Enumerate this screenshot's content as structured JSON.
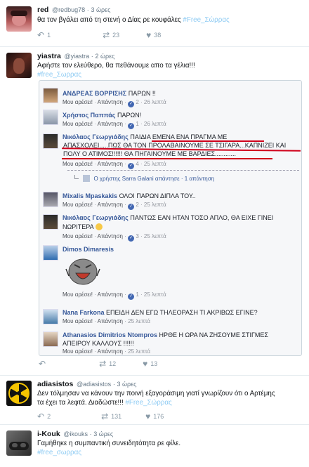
{
  "tweets": [
    {
      "name": "red",
      "handle": "@redbug78",
      "time": "3 ώρες",
      "text": "θα τον βγάλει από τη στενή ο Δίας ρε κουφάλες ",
      "hashtag": "#Free_Σώρρας",
      "replies": "1",
      "retweets": "23",
      "likes": "38"
    },
    {
      "name": "yiastra",
      "handle": "@yiastra",
      "time": "2 ώρες",
      "text": "Αφήστε τον ελεύθερο, θα πεθάνουμε απο τα γέλια!!!",
      "hashtag": "#free_Σωρρας",
      "replies": "",
      "retweets": "12",
      "likes": "13"
    },
    {
      "name": "adiasistos",
      "handle": "@adiasistos",
      "time": "3 ώρες",
      "text_line1": "Δεν τόλμησαν να κάνουν την ποινή εξαγοράσιμη γιατί γνωρίζουν ότι ο Αρτέμης",
      "text_line2": "τα έχει τα λεφτά. Διαδώστε!!! ",
      "hashtag": "#Free_Σώρρας",
      "replies": "2",
      "retweets": "131",
      "likes": "176"
    },
    {
      "name": "i-Kouk",
      "handle": "@ikouks",
      "time": "3 ώρες",
      "text": "Γαμήθηκε η συμπαντική συνειδητότητα ρε φίλε.",
      "hashtag": "#free_σωρρας"
    }
  ],
  "fb_comments": [
    {
      "name": "ΑΝΔΡΕΑΣ ΒΟΡΡΙΣΗΣ",
      "text": "ΠΑΡΩΝ !!",
      "like": "Μου αρέσει!",
      "reply": "Απάντηση",
      "count": "2",
      "time": "26 λεπτά"
    },
    {
      "name": "Χρήστος Παππάς",
      "text": "ΠΑΡΩΝ!",
      "like": "Μου αρέσει!",
      "reply": "Απάντηση",
      "count": "1",
      "time": "26 λεπτά"
    },
    {
      "name": "Νικόλαος Γεωργιάδης",
      "text1": "ΠΑΙΔΙΑ ΕΜΕΝΑ ΕΝΑ ΠΡΑΓΜΑ ΜΕ",
      "text2": "ΑΠΑΣΧΟΛΕΙ.....ΠΩΣ ΘΑ ΤΟΝ ΠΡΟΛΑΒΑΙΝΟΥΜΕ ΣΕ ΤΣΙΓΑΡΑ...ΚΑΠΝΙΖΕΙ ΚΑΙ",
      "text3": "ΠΟΛΥ Ο ΑΤΙΜΟΣ!!!!!! ΘΑ ΠΗΓΑΙΝΟΥΜΕ ΜΕ ΒΑΡΔΙΕΣ............",
      "like": "Μου αρέσει!",
      "reply": "Απάντηση",
      "count": "4",
      "time": "25 λεπτά",
      "sub_reply": "Ο χρήστης Sarra Galani απάντησε · 1 απάντηση"
    },
    {
      "name": "Mixalis Mpaskakis",
      "text": "ΟΛΟΙ ΠΑΡΩΝ ΔΙΠΛΑ ΤΟΥ..",
      "like": "Μου αρέσει!",
      "reply": "Απάντηση",
      "count": "2",
      "time": "25 λεπτά"
    },
    {
      "name": "Νικόλαος Γεωργιάδης",
      "text1": "ΠΑΝΤΩΣ ΕΑΝ ΗΤΑΝ ΤΟΣΟ ΑΠΛΟ, ΘΑ ΕΙΧΕ ΓΙΝΕΙ",
      "text2": "ΝΩΡΙΤΕΡΑ",
      "like": "Μου αρέσει!",
      "reply": "Απάντηση",
      "count": "3",
      "time": "25 λεπτά"
    },
    {
      "name": "Dimos Dimaresis",
      "like": "Μου αρέσει!",
      "reply": "Απάντηση",
      "count": "1",
      "time": "25 λεπτά"
    },
    {
      "name": "Nana Farkona",
      "text": "ΕΠΕΙΔΗ ΔΕΝ ΕΓΩ ΤΗΛΕΟΡΑΣΗ ΤΙ ΑΚΡΙΒΩΣ ΕΓΙΝΕ?",
      "like": "Μου αρέσει!",
      "reply": "Απάντηση",
      "time": "25 λεπτά"
    },
    {
      "name": "Athanasios Dimitrios Ntompros",
      "text1": "ΗΡΘΕ Η ΩΡΑ ΝΑ ΖΗΣΟΥΜΕ ΣΤΙΓΜΕΣ",
      "text2": "ΑΠΕΙΡΟΥ ΚΑΛΛΟΥΣ !!!!!!",
      "like": "Μου αρέσει!",
      "reply": "Απάντηση",
      "time": "25 λεπτά"
    }
  ],
  "colors": {
    "link": "#1da1f2",
    "fb_name": "#365899",
    "underline": "#d0021b",
    "muted": "#657786"
  }
}
